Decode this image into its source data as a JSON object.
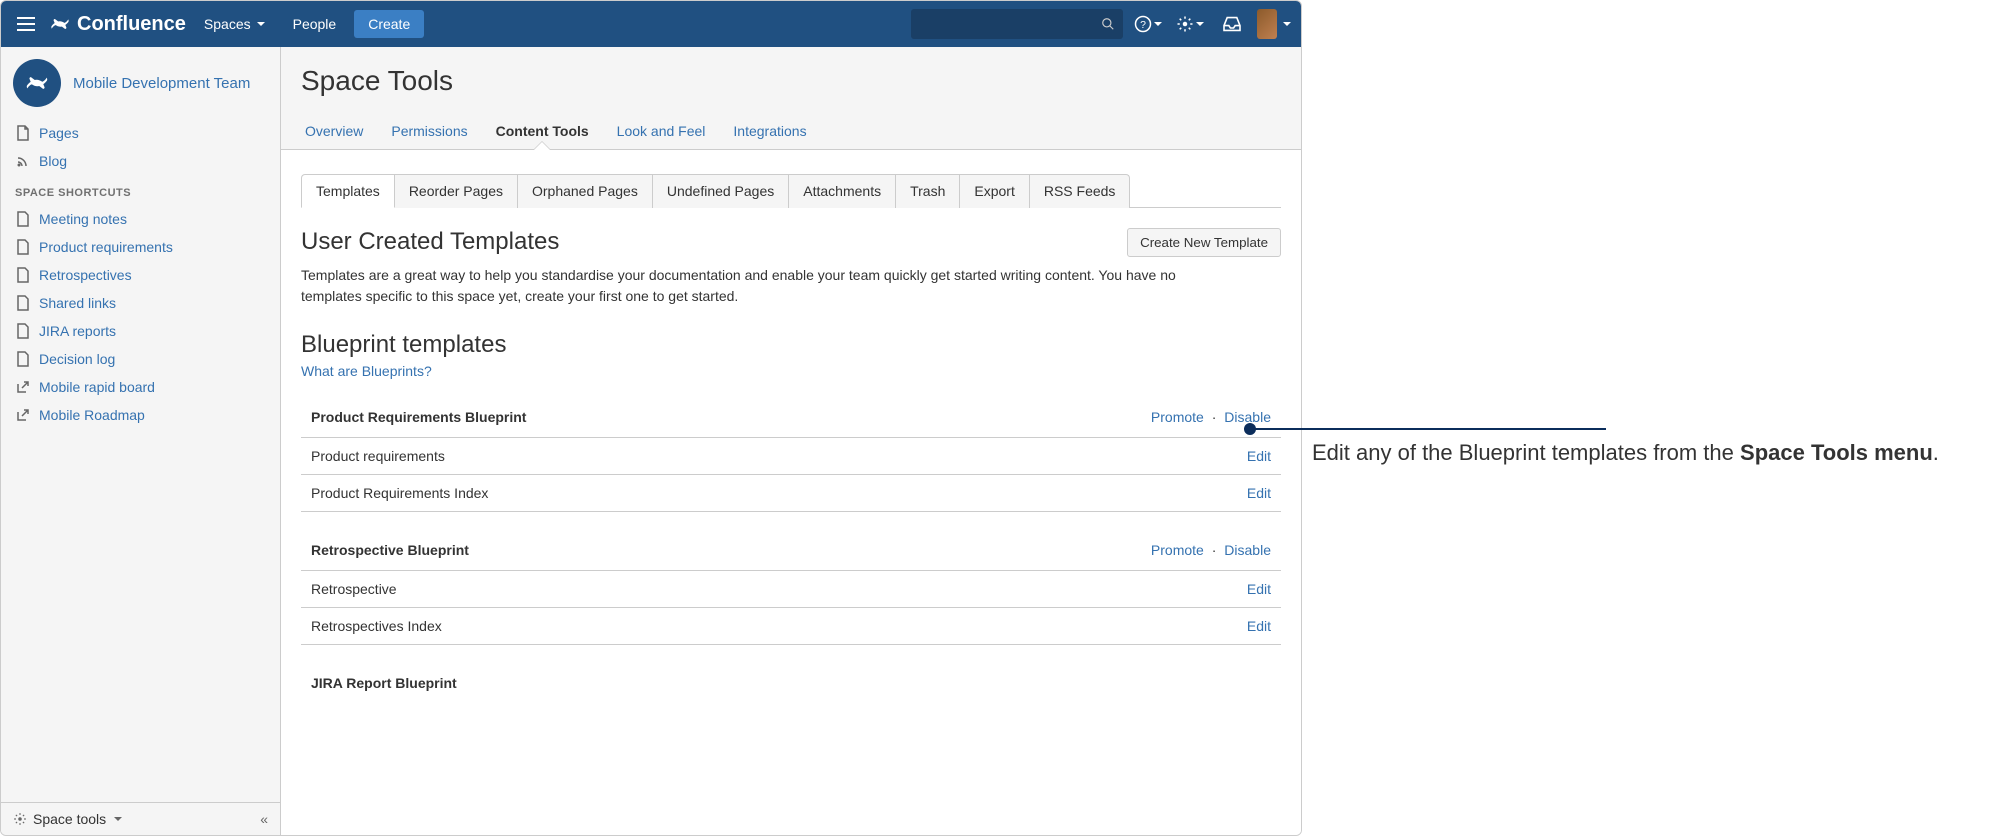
{
  "header": {
    "product": "Confluence",
    "spaces": "Spaces",
    "people": "People",
    "create": "Create"
  },
  "sidebar": {
    "space_name": "Mobile Development Team",
    "pages": "Pages",
    "blog": "Blog",
    "shortcuts_heading": "SPACE SHORTCUTS",
    "shortcuts": [
      "Meeting notes",
      "Product requirements",
      "Retrospectives",
      "Shared links",
      "JIRA reports",
      "Decision log",
      "Mobile rapid board",
      "Mobile Roadmap"
    ],
    "footer": "Space tools"
  },
  "main": {
    "title": "Space Tools",
    "tabs": [
      "Overview",
      "Permissions",
      "Content Tools",
      "Look and Feel",
      "Integrations"
    ],
    "subtabs": [
      "Templates",
      "Reorder Pages",
      "Orphaned Pages",
      "Undefined Pages",
      "Attachments",
      "Trash",
      "Export",
      "RSS Feeds"
    ],
    "section_title": "User Created Templates",
    "create_template_btn": "Create New Template",
    "desc": "Templates are a great way to help you standardise your documentation and enable your team quickly get started writing content. You have no templates specific to this space yet, create your first one to get started.",
    "blueprints_title": "Blueprint templates",
    "blueprints_link": "What are Blueprints?",
    "promote": "Promote",
    "disable": "Disable",
    "edit": "Edit",
    "groups": [
      {
        "name": "Product Requirements Blueprint",
        "rows": [
          "Product requirements",
          "Product Requirements Index"
        ]
      },
      {
        "name": "Retrospective Blueprint",
        "rows": [
          "Retrospective",
          "Retrospectives Index"
        ]
      },
      {
        "name": "JIRA Report Blueprint",
        "rows": []
      }
    ]
  },
  "annotation": {
    "pre": "Edit any of the Blueprint templates from the ",
    "bold": "Space Tools menu",
    "post": "."
  }
}
